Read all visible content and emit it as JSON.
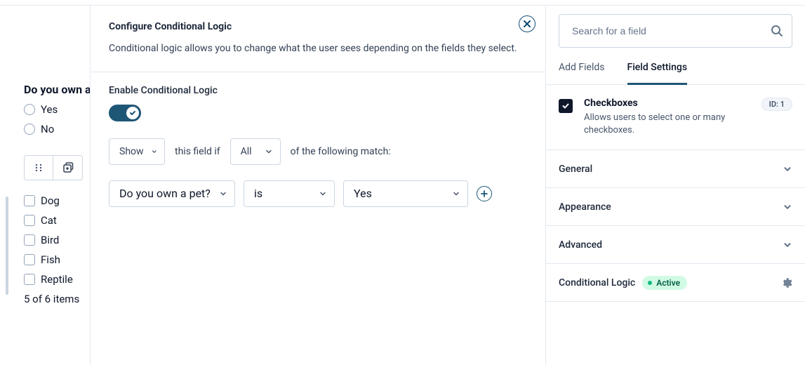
{
  "left": {
    "question": "Do you own a",
    "radios": [
      "Yes",
      "No"
    ],
    "checkboxes": [
      "Dog",
      "Cat",
      "Bird",
      "Fish",
      "Reptile"
    ],
    "itemsCount": "5 of 6 items"
  },
  "modal": {
    "title": "Configure Conditional Logic",
    "description": "Conditional logic allows you to change what the user sees depending on the fields they select.",
    "enableLabel": "Enable Conditional Logic",
    "ruleText1": "this field if",
    "ruleText2": "of the following match:",
    "showSelect": "Show",
    "matchSelect": "All",
    "condField": "Do you own a pet?",
    "condOp": "is",
    "condVal": "Yes"
  },
  "right": {
    "searchPlaceholder": "Search for a field",
    "tabs": {
      "add": "Add Fields",
      "settings": "Field Settings"
    },
    "field": {
      "title": "Checkboxes",
      "desc": "Allows users to select one or many checkboxes.",
      "id": "ID: 1"
    },
    "sections": {
      "general": "General",
      "appearance": "Appearance",
      "advanced": "Advanced",
      "conditional": "Conditional Logic",
      "status": "Active"
    }
  }
}
